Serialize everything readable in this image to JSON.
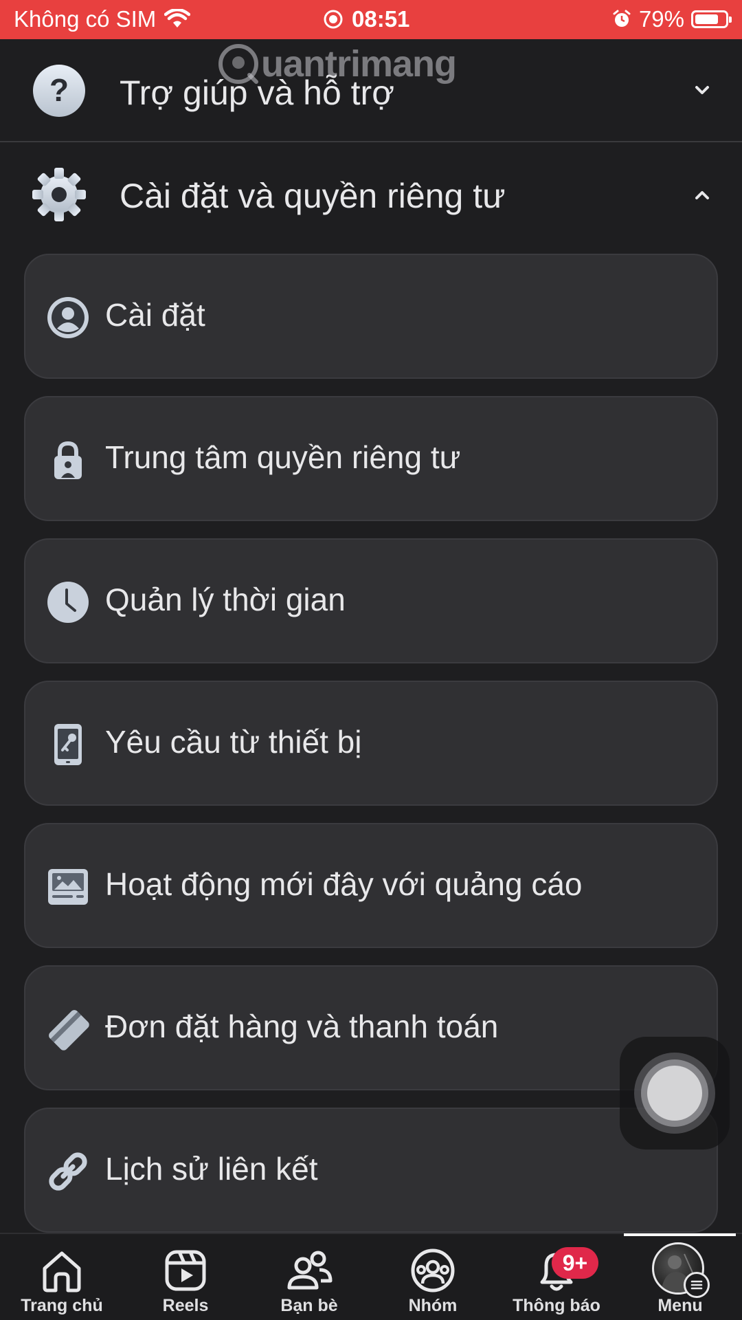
{
  "status_bar": {
    "carrier": "Không có SIM",
    "time": "08:51",
    "battery": "79%",
    "battery_level": 0.79,
    "background_color": "#e8403f"
  },
  "watermark": {
    "text": "uantrimang"
  },
  "sections": [
    {
      "label": "Trợ giúp và hỗ trợ",
      "icon": "help-circle-icon",
      "expanded": false
    },
    {
      "label": "Cài đặt và quyền riêng tư",
      "icon": "gear-icon",
      "expanded": true
    }
  ],
  "settings_items": [
    {
      "label": "Cài đặt",
      "icon": "profile-settings-icon"
    },
    {
      "label": "Trung tâm quyền riêng tư",
      "icon": "lock-icon"
    },
    {
      "label": "Quản lý thời gian",
      "icon": "clock-icon"
    },
    {
      "label": "Yêu cầu từ thiết bị",
      "icon": "device-key-icon"
    },
    {
      "label": "Hoạt động mới đây với quảng cáo",
      "icon": "ad-activity-icon"
    },
    {
      "label": "Đơn đặt hàng và thanh toán",
      "icon": "payment-card-icon"
    },
    {
      "label": "Lịch sử liên kết",
      "icon": "link-icon"
    }
  ],
  "tab_bar": {
    "tabs": [
      {
        "label": "Trang chủ",
        "icon": "home-icon"
      },
      {
        "label": "Reels",
        "icon": "reels-icon"
      },
      {
        "label": "Bạn bè",
        "icon": "friends-icon"
      },
      {
        "label": "Nhóm",
        "icon": "groups-icon"
      },
      {
        "label": "Thông báo",
        "icon": "bell-icon"
      },
      {
        "label": "Menu",
        "icon": "avatar-menu-icon"
      }
    ],
    "notification_badge": "9+",
    "active_tab": "Menu",
    "badge_color": "#e0284a"
  }
}
